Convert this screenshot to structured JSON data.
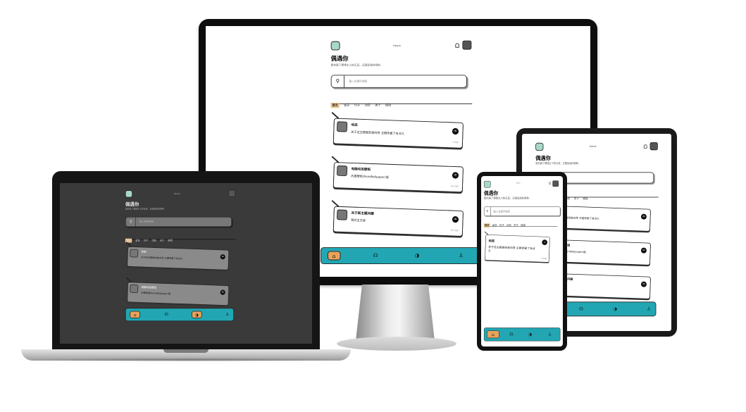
{
  "app": {
    "top_title": "Home",
    "heading": "偶遇你",
    "subtitle": "是你离了理想主义的天真，无限延续的两种。",
    "search_placeholder": "输入关键字搜索",
    "tabs": [
      {
        "label": "首页",
        "active": true
      },
      {
        "label": "留言"
      },
      {
        "label": "句子"
      },
      {
        "label": "动态"
      },
      {
        "label": "关于"
      },
      {
        "label": "链接"
      }
    ],
    "cards": [
      {
        "title": "动态",
        "desc": "关于这主题做安装向导 主题停更了有点久",
        "meta": "3 天前"
      },
      {
        "title": "电脑动态壁纸",
        "desc": "内置壁纸(RxinWallpaper)版",
        "meta": "4天 天前"
      },
      {
        "title": "关于新主题问题",
        "desc": "我的主文章",
        "meta": "4天 天前"
      }
    ],
    "bottom_nav": [
      {
        "icon": "home-icon",
        "glyph": "⌂",
        "active": true
      },
      {
        "icon": "headphones-icon",
        "glyph": "☊"
      },
      {
        "icon": "compass-icon",
        "glyph": "◑"
      },
      {
        "icon": "user-icon",
        "glyph": "♙"
      }
    ]
  },
  "colors": {
    "accent_teal": "#22a6b3",
    "accent_orange": "#e9a35a",
    "logo_mint": "#a7d8c9",
    "tab_highlight": "#e7c28c",
    "dark_bg": "#3a3a3a"
  }
}
